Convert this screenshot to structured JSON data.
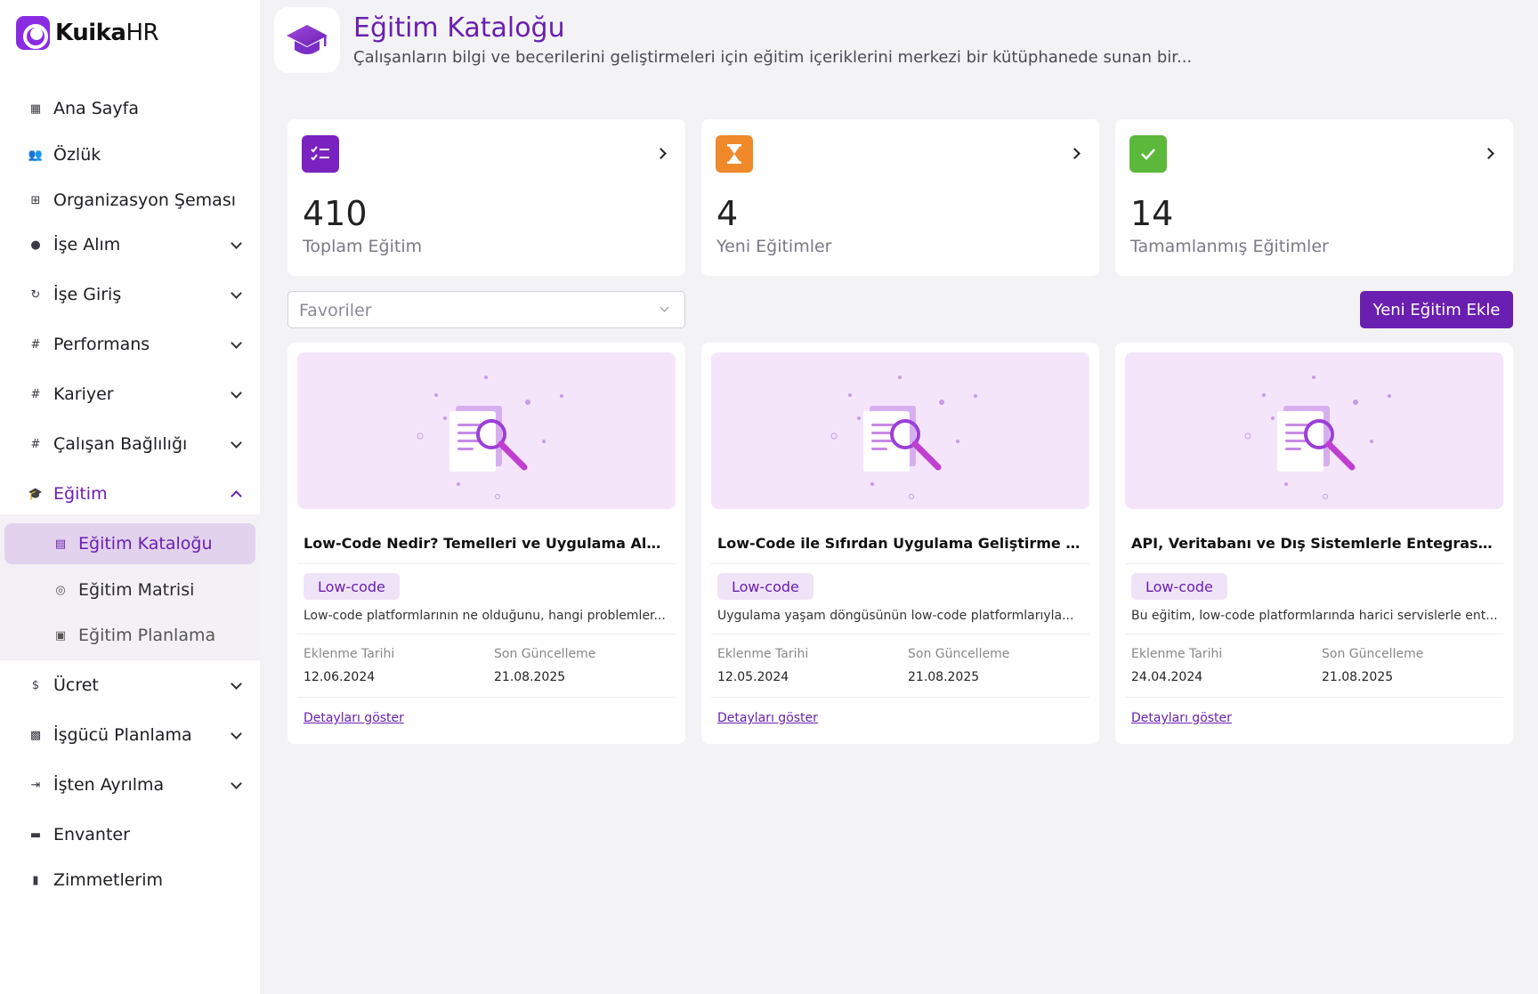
{
  "brand": {
    "name": "Kuika",
    "suffix": "HR",
    "color": "#8a2be2"
  },
  "accent": "#6a1fb0",
  "sidebar": {
    "items": [
      {
        "label": "Ana Sayfa",
        "icon": "dashboard-icon"
      },
      {
        "label": "Özlük",
        "icon": "people-icon"
      },
      {
        "label": "Organizasyon Şeması",
        "icon": "org-chart-icon"
      },
      {
        "label": "İşe Alım",
        "icon": "person-circle-icon"
      },
      {
        "label": "İşe Giriş",
        "icon": "onboarding-icon"
      },
      {
        "label": "Performans",
        "icon": "hash-icon"
      },
      {
        "label": "Kariyer",
        "icon": "hash-icon"
      },
      {
        "label": "Çalışan Bağlılığı",
        "icon": "hash-icon"
      },
      {
        "label": "Eğitim",
        "icon": "graduation-cap-icon"
      },
      {
        "label": "Ücret",
        "icon": "dollar-icon"
      },
      {
        "label": "İşgücü Planlama",
        "icon": "briefcase-icon"
      },
      {
        "label": "İşten Ayrılma",
        "icon": "exit-icon"
      },
      {
        "label": "Envanter",
        "icon": "archive-icon"
      },
      {
        "label": "Zimmetlerim",
        "icon": "bookmark-icon"
      }
    ],
    "egitim_sub": [
      {
        "label": "Eğitim Kataloğu",
        "icon": "catalog-icon"
      },
      {
        "label": "Eğitim Matrisi",
        "icon": "matrix-icon"
      },
      {
        "label": "Eğitim Planlama",
        "icon": "calendar-icon"
      }
    ]
  },
  "header": {
    "title": "Eğitim Kataloğu",
    "description": "Çalışanların bilgi ve becerilerini geliştirmeleri için eğitim içeriklerini merkezi bir kütüphanede sunan bir..."
  },
  "stats": [
    {
      "value": "410",
      "label": "Toplam Eğitim",
      "color": "#7a22c0",
      "icon": "checklist-icon"
    },
    {
      "value": "4",
      "label": "Yeni Eğitimler",
      "color": "#f0892a",
      "icon": "hourglass-icon"
    },
    {
      "value": "14",
      "label": "Tamamlanmış Eğitimler",
      "color": "#5cb83a",
      "icon": "check-icon"
    }
  ],
  "filter": {
    "value": "Favoriler"
  },
  "add_button": "Yeni Eğitim Ekle",
  "labels": {
    "added": "Eklenme Tarihi",
    "updated": "Son Güncelleme",
    "details": "Detayları göster"
  },
  "courses": [
    {
      "title": "Low-Code Nedir? Temelleri ve Uygulama Alanları",
      "tag": "Low-code",
      "description": "Low-code platformlarının ne olduğunu, hangi problemler...",
      "added": "12.06.2024",
      "updated": "21.08.2025"
    },
    {
      "title": "Low-Code ile Sıfırdan Uygulama Geliştirme Adı...",
      "tag": "Low-code",
      "description": "Uygulama yaşam döngüsünün low-code platformlarıyla...",
      "added": "12.05.2024",
      "updated": "21.08.2025"
    },
    {
      "title": "API, Veritabanı ve Dış Sistemlerle Entegrasyon",
      "tag": "Low-code",
      "description": "Bu eğitim, low-code platformlarında harici servislerle ent...",
      "added": "24.04.2024",
      "updated": "21.08.2025"
    }
  ]
}
